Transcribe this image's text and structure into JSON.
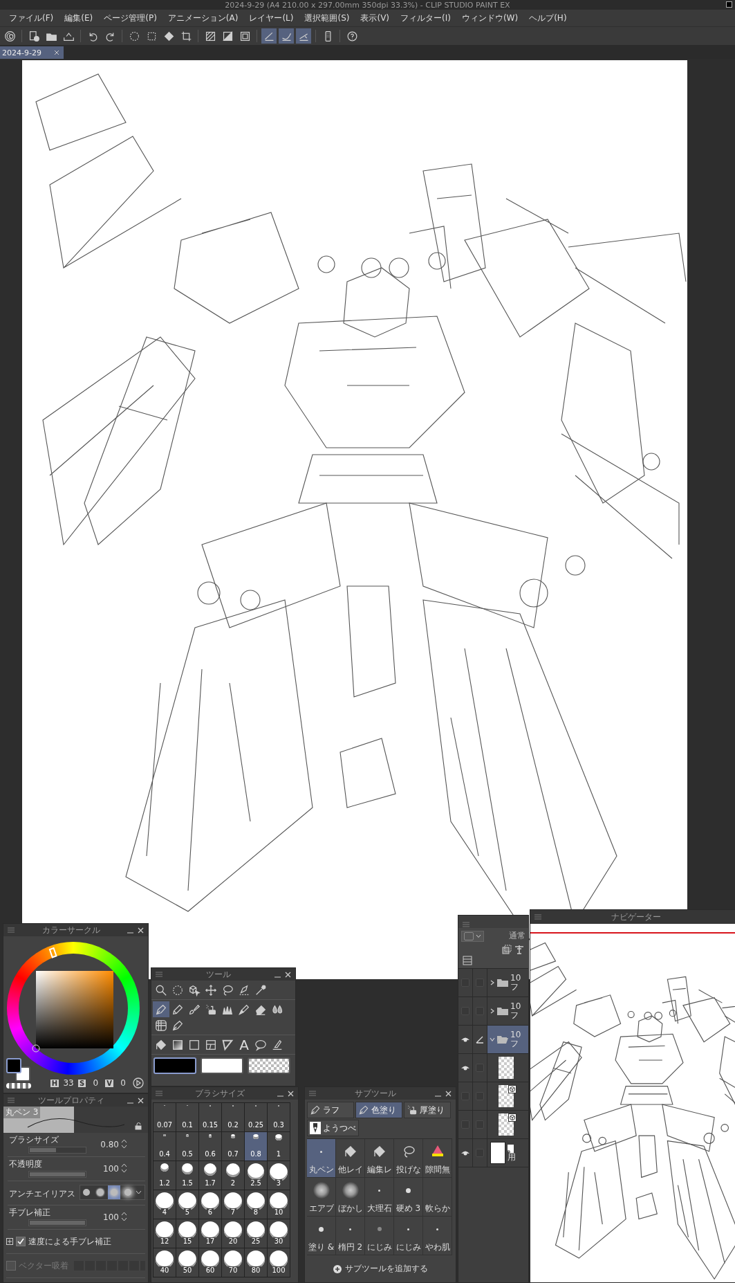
{
  "title": "2024-9-29 (A4 210.00 x 297.00mm 350dpi 33.3%) - CLIP STUDIO PAINT EX",
  "menu": [
    "ファイル(F)",
    "編集(E)",
    "ページ管理(P)",
    "アニメーション(A)",
    "レイヤー(L)",
    "選択範囲(S)",
    "表示(V)",
    "フィルター(I)",
    "ウィンドウ(W)",
    "ヘルプ(H)"
  ],
  "toolbar": [
    {
      "kind": "logo",
      "selected": false
    },
    {
      "kind": "new",
      "selected": false
    },
    {
      "kind": "open",
      "selected": false
    },
    {
      "kind": "export",
      "selected": false
    },
    {
      "kind": "undo",
      "selected": false
    },
    {
      "kind": "redo",
      "selected": false
    },
    {
      "kind": "select-all",
      "selected": false
    },
    {
      "kind": "deselect",
      "selected": false
    },
    {
      "kind": "fill",
      "selected": false
    },
    {
      "kind": "crop",
      "selected": false
    },
    {
      "kind": "hatch",
      "selected": false
    },
    {
      "kind": "half",
      "selected": false
    },
    {
      "kind": "frame",
      "selected": false
    },
    {
      "kind": "stroke",
      "selected": true
    },
    {
      "kind": "curve",
      "selected": true
    },
    {
      "kind": "ruler-stroke",
      "selected": true
    },
    {
      "kind": "device",
      "selected": false
    },
    {
      "kind": "help",
      "selected": false
    }
  ],
  "tabs": [
    {
      "label": "2024-9-29",
      "selected": true
    }
  ],
  "color_circle": {
    "title": "カラーサークル",
    "h_label": "H",
    "h": "33",
    "s_label": "S",
    "s": "0",
    "v_label": "V",
    "v": "0"
  },
  "tool_property": {
    "title": "ツールプロパティ",
    "preset": "丸ペン 3",
    "rows": [
      {
        "kind": "slider",
        "label": "ブラシサイズ",
        "value": "0.80",
        "level": 0.48
      },
      {
        "kind": "slider",
        "label": "不透明度",
        "value": "100",
        "level": 1
      },
      {
        "kind": "options",
        "label": "アンチエイリアス",
        "options": [
          {
            "selected": false
          },
          {
            "selected": false
          },
          {
            "selected": true
          },
          {
            "selected": false
          }
        ]
      },
      {
        "kind": "slider",
        "label": "手ブレ補正",
        "value": "100",
        "level": 1
      },
      {
        "kind": "checkbox",
        "label": "速度による手ブレ補正",
        "checked": true
      },
      {
        "kind": "snap",
        "label": "ベクター吸着",
        "checked": false,
        "disabled": true
      }
    ]
  },
  "tool_panel": {
    "title": "ツール",
    "groups": [
      [
        {
          "kind": "zoom",
          "selected": false
        },
        {
          "kind": "ellipse-select",
          "selected": false
        },
        {
          "kind": "object",
          "selected": false
        },
        {
          "kind": "move",
          "selected": false
        },
        {
          "kind": "lasso",
          "selected": false
        },
        {
          "kind": "pen-select",
          "selected": false
        },
        {
          "kind": "eyedropper",
          "selected": false
        }
      ],
      [
        {
          "kind": "pen",
          "selected": true
        },
        {
          "kind": "pencil",
          "selected": false
        },
        {
          "kind": "brush",
          "selected": false
        },
        {
          "kind": "airbrush",
          "selected": false
        },
        {
          "kind": "decoration",
          "selected": false
        },
        {
          "kind": "marker",
          "selected": false
        },
        {
          "kind": "eraser",
          "selected": false
        },
        {
          "kind": "blend",
          "selected": false
        },
        {
          "kind": "ruler",
          "selected": false
        },
        {
          "kind": "figure",
          "selected": false
        }
      ],
      [
        {
          "kind": "bucket",
          "selected": false
        },
        {
          "kind": "gradient",
          "selected": false
        },
        {
          "kind": "rect",
          "selected": false
        },
        {
          "kind": "frame-border",
          "selected": false
        },
        {
          "kind": "triangle",
          "selected": false
        },
        {
          "kind": "text",
          "label": "A",
          "selected": false
        },
        {
          "kind": "balloon",
          "selected": false
        },
        {
          "kind": "correct",
          "selected": false
        }
      ]
    ],
    "swatches": [
      {
        "kind": "main",
        "selected": true
      },
      {
        "kind": "sub",
        "selected": false
      },
      {
        "kind": "transparent",
        "selected": false
      }
    ]
  },
  "brush_size": {
    "title": "ブラシサイズ",
    "sizes": [
      {
        "label": "0.07",
        "selected": false
      },
      {
        "label": "0.1",
        "selected": false
      },
      {
        "label": "0.15",
        "selected": false
      },
      {
        "label": "0.2",
        "selected": false
      },
      {
        "label": "0.25",
        "selected": false
      },
      {
        "label": "0.3",
        "selected": false
      },
      {
        "label": "0.4",
        "selected": false
      },
      {
        "label": "0.5",
        "selected": false
      },
      {
        "label": "0.6",
        "selected": false
      },
      {
        "label": "0.7",
        "selected": false
      },
      {
        "label": "0.8",
        "selected": true
      },
      {
        "label": "1",
        "selected": false
      },
      {
        "label": "1.2",
        "selected": false
      },
      {
        "label": "1.5",
        "selected": false
      },
      {
        "label": "1.7",
        "selected": false
      },
      {
        "label": "2",
        "selected": false
      },
      {
        "label": "2.5",
        "selected": false
      },
      {
        "label": "3",
        "selected": false
      },
      {
        "label": "4",
        "selected": false
      },
      {
        "label": "5",
        "selected": false
      },
      {
        "label": "6",
        "selected": false
      },
      {
        "label": "7",
        "selected": false
      },
      {
        "label": "8",
        "selected": false
      },
      {
        "label": "10",
        "selected": false
      },
      {
        "label": "12",
        "selected": false
      },
      {
        "label": "15",
        "selected": false
      },
      {
        "label": "17",
        "selected": false
      },
      {
        "label": "20",
        "selected": false
      },
      {
        "label": "25",
        "selected": false
      },
      {
        "label": "30",
        "selected": false
      },
      {
        "label": "40",
        "selected": false
      },
      {
        "label": "50",
        "selected": false
      },
      {
        "label": "60",
        "selected": false
      },
      {
        "label": "70",
        "selected": false
      },
      {
        "label": "80",
        "selected": false
      },
      {
        "label": "100",
        "selected": false
      }
    ]
  },
  "sub_tool": {
    "title": "サブツール",
    "groups": [
      {
        "label": "ラフ",
        "kind": "pen",
        "selected": false
      },
      {
        "label": "色塗り",
        "kind": "pen",
        "selected": true
      },
      {
        "label": "厚塗り",
        "kind": "airbrush",
        "selected": false
      },
      {
        "label": "ようつべ",
        "kind": "custom",
        "selected": false
      }
    ],
    "items": [
      {
        "label": "丸ペン",
        "kind": "dot",
        "selected": true
      },
      {
        "label": "他レイ",
        "kind": "bucket",
        "selected": false
      },
      {
        "label": "編集レ",
        "kind": "bucket",
        "selected": false
      },
      {
        "label": "投げな",
        "kind": "lasso",
        "selected": false
      },
      {
        "label": "隙間無",
        "kind": "cake",
        "selected": false
      },
      {
        "label": "エアブ",
        "kind": "soft",
        "selected": false
      },
      {
        "label": "ぼかし",
        "kind": "soft",
        "selected": false
      },
      {
        "label": "大理石",
        "kind": "dot",
        "selected": false
      },
      {
        "label": "硬め 3",
        "kind": "hard",
        "selected": false
      },
      {
        "label": "軟らか",
        "kind": "none",
        "selected": false
      },
      {
        "label": "塗り &",
        "kind": "hard",
        "selected": false
      },
      {
        "label": "楕円 2",
        "kind": "dot",
        "selected": false
      },
      {
        "label": "にじみ",
        "kind": "blur",
        "selected": false
      },
      {
        "label": "にじみ",
        "kind": "dot",
        "selected": false
      },
      {
        "label": "やわ肌",
        "kind": "dot",
        "selected": false
      }
    ],
    "add_label": "サブツールを追加する"
  },
  "layers": {
    "blend": "通常",
    "items": [
      {
        "kind": "folder",
        "percent": "10",
        "name": "フ",
        "visible": false,
        "target": false,
        "expanded": false,
        "selected": false
      },
      {
        "kind": "folder",
        "percent": "10",
        "name": "フ",
        "visible": false,
        "target": false,
        "expanded": false,
        "selected": false
      },
      {
        "kind": "folder",
        "percent": "10",
        "name": "フ",
        "visible": true,
        "target": true,
        "expanded": true,
        "selected": true,
        "children": [
          {
            "kind": "raster",
            "visible": true
          },
          {
            "kind": "vector",
            "visible": false
          },
          {
            "kind": "vector",
            "visible": false
          }
        ]
      },
      {
        "kind": "paper",
        "name": "用",
        "visible": true,
        "target": false
      }
    ]
  },
  "navigator": {
    "title": "ナビゲーター"
  }
}
